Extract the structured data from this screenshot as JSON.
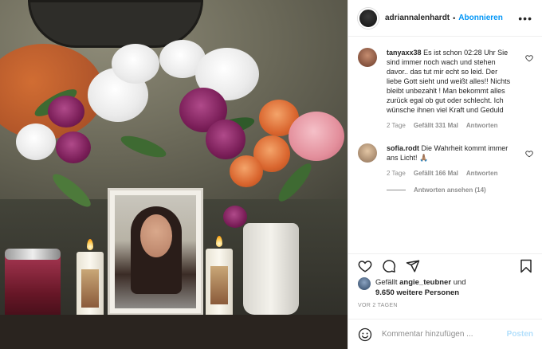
{
  "header": {
    "username": "adriannalenhardt",
    "separator": "•",
    "follow_label": "Abonnieren",
    "more_label": "•••"
  },
  "comments": [
    {
      "username": "tanyaxx38",
      "text": "Es ist schon 02:28 Uhr Sie sind immer noch wach und stehen davor.. das tut mir echt so leid. Der liebe Gott sieht und weißt alles!! Nichts bleibt unbezahlt ! Man bekommt alles zurück egal ob gut oder schlecht. Ich wünsche ihnen viel Kraft und Geduld",
      "age": "2 Tage",
      "likes": "Gefällt 331 Mal",
      "reply": "Antworten"
    },
    {
      "username": "sofia.rodt",
      "text": "Die Wahrheit kommt immer ans Licht! 🙏🏽",
      "age": "2 Tage",
      "likes": "Gefällt 166 Mal",
      "reply": "Antworten",
      "view_replies": "Antworten ansehen (14)"
    }
  ],
  "likes": {
    "prefix": "Gefällt",
    "user": "angie_teubner",
    "connector": "und",
    "others": "9.650 weitere Personen"
  },
  "date": "VOR 2 TAGEN",
  "add_comment": {
    "placeholder": "Kommentar hinzufügen ...",
    "post_label": "Posten"
  },
  "colors": {
    "link_blue": "#0095f6",
    "post_disabled": "#b2dffc",
    "muted": "#8e8e8e"
  },
  "icons": [
    "more-icon",
    "heart-icon",
    "comment-icon",
    "share-icon",
    "bookmark-icon",
    "emoji-icon"
  ]
}
